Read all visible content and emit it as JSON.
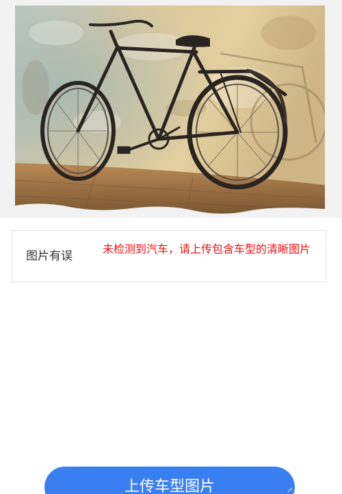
{
  "photo": {
    "alt": "bicycle-photo"
  },
  "result": {
    "label": "图片有误",
    "message": "未检测到汽车，请上传包含车型的清晰图片",
    "message_color": "#ee1111"
  },
  "upload": {
    "button_label": "上传车型图片",
    "button_color": "#3a7ff2"
  }
}
